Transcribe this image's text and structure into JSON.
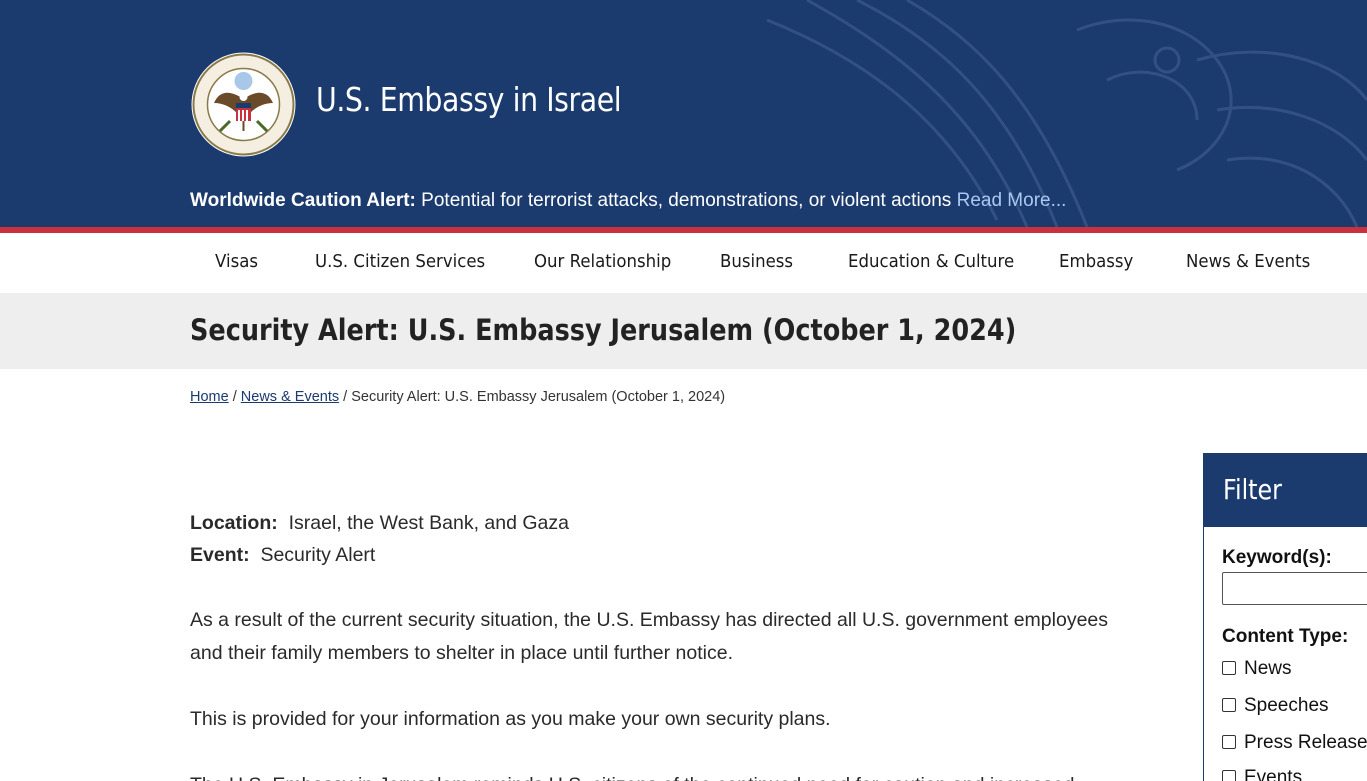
{
  "header": {
    "site_title": "U.S. Embassy in Israel",
    "alert_label": "Worldwide Caution Alert:",
    "alert_text": "Potential for terrorist attacks, demonstrations, or violent actions",
    "alert_link": "Read More..."
  },
  "nav": {
    "items": [
      {
        "label": "Visas"
      },
      {
        "label": "U.S. Citizen Services"
      },
      {
        "label": "Our Relationship"
      },
      {
        "label": "Business"
      },
      {
        "label": "Education & Culture"
      },
      {
        "label": "Embassy"
      },
      {
        "label": "News & Events"
      }
    ]
  },
  "page": {
    "title": "Security Alert: U.S. Embassy Jerusalem (October 1, 2024)"
  },
  "breadcrumb": {
    "home": "Home",
    "separator": "/",
    "section": "News & Events",
    "current": "Security Alert: U.S. Embassy Jerusalem (October 1, 2024)"
  },
  "content": {
    "location_label": "Location:",
    "location_value": "Israel, the West Bank, and Gaza",
    "event_label": "Event:",
    "event_value": "Security Alert",
    "paragraphs": [
      "As a result of the current security situation, the U.S. Embassy has directed all U.S. government employees and their family members to shelter in place until further notice.",
      "This is provided for your information as you make your own security plans.",
      "The U.S. Embassy in Jerusalem reminds U.S. citizens of the continued need for caution and increased"
    ]
  },
  "filter": {
    "title": "Filter",
    "keyword_label": "Keyword(s):",
    "keyword_value": "",
    "content_type_label": "Content Type:",
    "options": [
      {
        "label": "News",
        "checked": false
      },
      {
        "label": "Speeches",
        "checked": false
      },
      {
        "label": "Press Releases",
        "checked": false
      },
      {
        "label": "Events",
        "checked": false
      }
    ]
  },
  "colors": {
    "header_bg": "#1b3a6e",
    "accent_red": "#c8313d",
    "link": "#a9c8f2",
    "title_band": "#eeeeee"
  },
  "icons": {
    "seal": "department-of-state-seal",
    "background": "eagle-watermark"
  }
}
